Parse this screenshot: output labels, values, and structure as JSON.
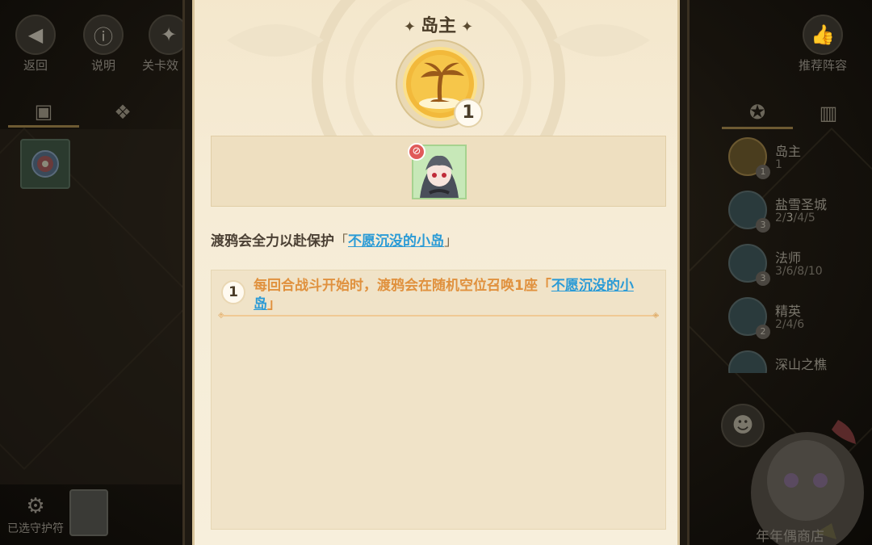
{
  "toolbar": {
    "back_label": "返回",
    "help_label": "说明",
    "stage_effect_label": "关卡效",
    "recommend_label": "推荐阵容"
  },
  "left_panel": {
    "guard_label": "已选守护符"
  },
  "right_panel": {
    "traits": [
      {
        "name": "岛主",
        "tiers": "1",
        "active_tier": "",
        "count": "1"
      },
      {
        "name": "盐雪圣城",
        "tiers_pre": "2/",
        "active_tier": "3",
        "tiers_post": "/4/5",
        "count": "3"
      },
      {
        "name": "法师",
        "tiers": "3/6/8/10",
        "count": "3"
      },
      {
        "name": "精英",
        "tiers": "2/4/6",
        "count": "2"
      },
      {
        "name": "深山之樵",
        "tiers": "",
        "count": ""
      }
    ],
    "shop_label": "年年偶商店"
  },
  "modal": {
    "title": "岛主",
    "emblem_count": "1",
    "description": "渡鸦会全力以赴保护",
    "desc_link": "不愿沉没的小岛",
    "bracket_open": "「",
    "bracket_close": "」",
    "effect": {
      "tier": "1",
      "text": "每回合战斗开始时，渡鸦会在随机空位召唤1座",
      "link": "不愿沉没的小岛"
    }
  },
  "colors": {
    "modal_bg": "#f6ecd6",
    "link": "#2b9bd6",
    "effect_text": "#e0913e",
    "emblem_gold": "#f2b93b"
  }
}
